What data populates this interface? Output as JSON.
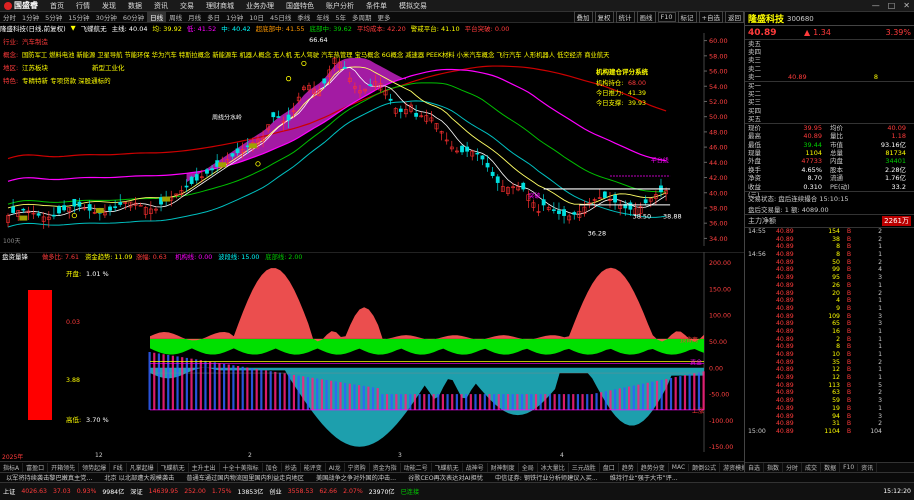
{
  "menubar": {
    "logo": "国盛睿",
    "items": [
      "首页",
      "行情",
      "发现",
      "数据",
      "资讯",
      "交易",
      "理财商城",
      "业务办理",
      "国盛特色",
      "账户分析",
      "条件单",
      "模拟交易"
    ],
    "window_buttons": [
      "—",
      "□",
      "✕"
    ]
  },
  "toolbar": {
    "items": [
      "分时",
      "1分钟",
      "5分钟",
      "15分钟",
      "30分钟",
      "60分钟",
      "日线",
      "周线",
      "月线",
      "多日",
      "1分钟",
      "10日",
      "45日线",
      "季线",
      "年线",
      "5年",
      "多周期",
      "更多"
    ],
    "active_index": 6,
    "right_items": [
      "叠加",
      "复权",
      "统计",
      "画线",
      "F10",
      "标记",
      "+自选",
      "返回"
    ]
  },
  "infobar": {
    "stock": "隆盛科技(日线,前复权)",
    "arrow": "▼",
    "ma_label": "飞蝶航无",
    "items": [
      {
        "t": "主线: 40.04",
        "c": "wht"
      },
      {
        "t": "均: 39.92",
        "c": "yel"
      },
      {
        "t": "低: 41.52",
        "c": "mag"
      },
      {
        "t": "中: 40.42",
        "c": "cyan"
      },
      {
        "t": "超底部中: 41.55",
        "c": "org"
      },
      {
        "t": "底部中: 39.62",
        "c": "green"
      },
      {
        "t": "平均成本: 42.20",
        "c": "red"
      },
      {
        "t": "警戒平台: 41.10",
        "c": "yel"
      },
      {
        "t": "平台突破: 0.00",
        "c": "red"
      }
    ]
  },
  "chart_info": {
    "industry_label": "行业:",
    "industry": "汽车制造",
    "concept_label": "概念:",
    "concepts": "国防军工 燃料电池 新能源 卫星导航 节能环保 华为汽车 特斯拉概念 新能源车 机器人概念 无人机 无人驾驶 汽车热管理 宝马概念 6G概念 减速器 PEEK材料 小米汽车概念 飞行汽车 人形机器人 低空经济 商业航天",
    "region_label": "地区:",
    "region": "江苏板块",
    "region_extra": "新型工业化",
    "special_label": "特色:",
    "special": "专精特新 专项贷款 深股通标的",
    "score_title": "机构建仓评分系统",
    "score_items": [
      {
        "label": "机构持仓:",
        "value": "68.00",
        "c": "red"
      },
      {
        "label": "今日推力:",
        "value": "41.39",
        "c": "yel"
      },
      {
        "label": "今日支撑:",
        "value": "39.93",
        "c": "yel"
      }
    ],
    "peak_label": "66.64",
    "low1": "36.28",
    "low2": "38.50",
    "low3": "38.88",
    "note_label": "突破",
    "bottom_label": "平台线",
    "ma_note": "周线分水岭",
    "subtitle": "100天",
    "y_labels": [
      "60.00",
      "58.00",
      "56.00",
      "54.00",
      "52.00",
      "50.00",
      "48.00",
      "46.00",
      "44.00",
      "42.00",
      "40.00",
      "38.00",
      "36.00",
      "34.00"
    ]
  },
  "indicator": {
    "title": "盘资量锋",
    "params": [
      {
        "t": "做多比: 7.61",
        "c": "red"
      },
      {
        "t": "资金趋势: 11.09",
        "c": "yel"
      },
      {
        "t": "涨幅: 0.63",
        "c": "red"
      },
      {
        "t": "机构线: 0.00",
        "c": "mag"
      },
      {
        "t": "波段线: 15.00",
        "c": "cyan"
      },
      {
        "t": "底部线: 2.00",
        "c": "green"
      }
    ],
    "open_label": "开盘:",
    "open_value": "1.01 %",
    "high_label": "高低:",
    "high_value": "3.70 %",
    "mid1": "0.03",
    "mid2": "3.88",
    "right_tag1": "顶背离",
    "right_tag2": "资金",
    "right_tag3": "上涨",
    "y_labels": [
      "200.00",
      "150.00",
      "100.00",
      "50.00",
      "0.00",
      "-50.00",
      "-100.00",
      "-150.00"
    ]
  },
  "yearbar": {
    "year": "2025年",
    "ticks": [
      "12",
      "2",
      "3",
      "4"
    ]
  },
  "bottomtabs": {
    "items": [
      "指标A",
      "富盈口",
      "开箱领先",
      "领势起爆",
      "F线",
      "凡掌起爆",
      "飞蝶航无",
      "主升主出",
      "十全十美指标",
      "加仓",
      "抄选",
      "能评变",
      "AI龙",
      "宁资购",
      "资金为指",
      "动能二号",
      "飞蝶航无",
      "战神号",
      "财神制度",
      "全局",
      "冰大量比",
      "三元战胜",
      "盘口",
      "趋势",
      "趋势分变",
      "MAC",
      "颠倒公式",
      "游资模拟",
      "多空量",
      "短线精选",
      "指标中",
      "其他↕"
    ],
    "active_index": 29,
    "right_label": "日线"
  },
  "ticker": {
    "items": [
      "以军将持续袭击黎巴嫩真主党...",
      "北京 以北部遭大规模袭击",
      "普通车通过国内物流园里国内利益走向地区",
      "美国战争之争对外国的冲击...",
      "谷歌CEO再次表达对AI担忧",
      "中信证券: 钢铁行业分析师建议入买...",
      "维持行业“强于大市”评..."
    ]
  },
  "statusbar": {
    "items": [
      {
        "t": "上证",
        "c": "wht"
      },
      {
        "t": "4026.63",
        "c": "red"
      },
      {
        "t": "37.03",
        "c": "red"
      },
      {
        "t": "0.93%",
        "c": "red"
      },
      {
        "t": "9984亿",
        "c": "wht"
      },
      {
        "t": "深证",
        "c": "wht"
      },
      {
        "t": "14639.95",
        "c": "red"
      },
      {
        "t": "252.00",
        "c": "red"
      },
      {
        "t": "1.75%",
        "c": "red"
      },
      {
        "t": "13853亿",
        "c": "wht"
      },
      {
        "t": "创业",
        "c": "wht"
      },
      {
        "t": "3558.53",
        "c": "red"
      },
      {
        "t": "62.66",
        "c": "red"
      },
      {
        "t": "2.07%",
        "c": "red"
      },
      {
        "t": "23970亿",
        "c": "wht"
      },
      {
        "t": "已连接",
        "c": "green"
      }
    ],
    "clock": "15:12:20"
  },
  "rightpanel": {
    "name": "隆盛科技",
    "code": "300680",
    "price": "40.89",
    "change": "1.34",
    "pct": "3.39%",
    "sells": [
      {
        "l": "卖五",
        "p": "",
        "v": ""
      },
      {
        "l": "卖四",
        "p": "",
        "v": ""
      },
      {
        "l": "卖三",
        "p": "",
        "v": ""
      },
      {
        "l": "卖二",
        "p": "",
        "v": ""
      },
      {
        "l": "卖一",
        "p": "40.89",
        "v": "8"
      }
    ],
    "buys": [
      {
        "l": "买一",
        "p": "",
        "v": ""
      },
      {
        "l": "买二",
        "p": "",
        "v": ""
      },
      {
        "l": "买三",
        "p": "",
        "v": ""
      },
      {
        "l": "买四",
        "p": "",
        "v": ""
      },
      {
        "l": "买五",
        "p": "",
        "v": ""
      }
    ],
    "quotes": [
      {
        "k1": "现价",
        "v1": "39.95",
        "c1": "red",
        "k2": "均价",
        "v2": "40.09",
        "c2": "red"
      },
      {
        "k1": "最高",
        "v1": "40.89",
        "c1": "red",
        "k2": "量比",
        "v2": "1.18",
        "c2": "red"
      },
      {
        "k1": "最低",
        "v1": "39.44",
        "c1": "green",
        "k2": "市值",
        "v2": "93.16亿",
        "c2": "wht"
      },
      {
        "k1": "现量",
        "v1": "1104",
        "c1": "yel",
        "k2": "总量",
        "v2": "81734",
        "c2": "yel"
      },
      {
        "k1": "外盘",
        "v1": "47733",
        "c1": "red",
        "k2": "内盘",
        "v2": "34401",
        "c2": "green"
      },
      {
        "k1": "换手",
        "v1": "4.65%",
        "c1": "wht",
        "k2": "股本",
        "v2": "2.28亿",
        "c2": "wht"
      },
      {
        "k1": "净资",
        "v1": "8.70",
        "c1": "wht",
        "k2": "流通",
        "v2": "1.76亿",
        "c2": "wht"
      },
      {
        "k1": "收益(三)",
        "v1": "0.310",
        "c1": "wht",
        "k2": "PE(动)",
        "v2": "33.2",
        "c2": "wht"
      }
    ],
    "status_line": "交易状态: 盘后连续撮合 15:10:15",
    "after_line": "盘后交易量: 1   额: 4089.00",
    "flow_label": "主力净额",
    "flow_value": "2261万",
    "trades": [
      {
        "t": "14:55",
        "p": "40.89",
        "v": "154",
        "s": "B",
        "n": "2"
      },
      {
        "t": "",
        "p": "40.89",
        "v": "38",
        "s": "B",
        "n": "2"
      },
      {
        "t": "",
        "p": "40.89",
        "v": "8",
        "s": "B",
        "n": "1"
      },
      {
        "t": "14:56",
        "p": "40.89",
        "v": "8",
        "s": "B",
        "n": "1"
      },
      {
        "t": "",
        "p": "40.89",
        "v": "50",
        "s": "B",
        "n": "2"
      },
      {
        "t": "",
        "p": "40.89",
        "v": "99",
        "s": "B",
        "n": "4"
      },
      {
        "t": "",
        "p": "40.89",
        "v": "95",
        "s": "B",
        "n": "3"
      },
      {
        "t": "",
        "p": "40.89",
        "v": "26",
        "s": "B",
        "n": "1"
      },
      {
        "t": "",
        "p": "40.89",
        "v": "20",
        "s": "B",
        "n": "2"
      },
      {
        "t": "",
        "p": "40.89",
        "v": "4",
        "s": "B",
        "n": "1"
      },
      {
        "t": "",
        "p": "40.89",
        "v": "9",
        "s": "B",
        "n": "1"
      },
      {
        "t": "",
        "p": "40.89",
        "v": "109",
        "s": "B",
        "n": "3"
      },
      {
        "t": "",
        "p": "40.89",
        "v": "65",
        "s": "B",
        "n": "3"
      },
      {
        "t": "",
        "p": "40.89",
        "v": "16",
        "s": "B",
        "n": "1"
      },
      {
        "t": "",
        "p": "40.89",
        "v": "2",
        "s": "B",
        "n": "1"
      },
      {
        "t": "",
        "p": "40.89",
        "v": "8",
        "s": "B",
        "n": "1"
      },
      {
        "t": "",
        "p": "40.89",
        "v": "10",
        "s": "B",
        "n": "1"
      },
      {
        "t": "",
        "p": "40.89",
        "v": "35",
        "s": "B",
        "n": "2"
      },
      {
        "t": "",
        "p": "40.89",
        "v": "12",
        "s": "B",
        "n": "1"
      },
      {
        "t": "",
        "p": "40.89",
        "v": "12",
        "s": "B",
        "n": "1"
      },
      {
        "t": "",
        "p": "40.89",
        "v": "113",
        "s": "B",
        "n": "5"
      },
      {
        "t": "",
        "p": "40.89",
        "v": "63",
        "s": "B",
        "n": "2"
      },
      {
        "t": "",
        "p": "40.89",
        "v": "59",
        "s": "B",
        "n": "3"
      },
      {
        "t": "",
        "p": "40.89",
        "v": "19",
        "s": "B",
        "n": "1"
      },
      {
        "t": "",
        "p": "40.89",
        "v": "94",
        "s": "B",
        "n": "3"
      },
      {
        "t": "",
        "p": "40.89",
        "v": "31",
        "s": "B",
        "n": "2"
      },
      {
        "t": "15:00",
        "p": "40.89",
        "v": "1104",
        "s": "B",
        "n": "104"
      }
    ],
    "tabs": [
      "自选",
      "指数",
      "分时",
      "成交",
      "数据",
      "F10",
      "资讯"
    ],
    "news_line": "资讯"
  }
}
